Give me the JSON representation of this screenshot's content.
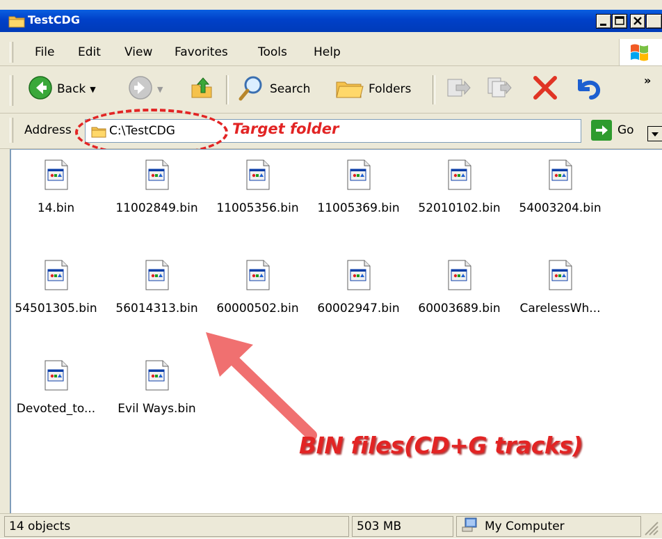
{
  "window": {
    "title": "TestCDG"
  },
  "menu": [
    "File",
    "Edit",
    "View",
    "Favorites",
    "Tools",
    "Help"
  ],
  "toolbar": {
    "back_label": "Back",
    "search_label": "Search",
    "folders_label": "Folders",
    "more": "»"
  },
  "address": {
    "label": "Address",
    "value": "C:\\TestCDG",
    "go_label": "Go"
  },
  "annotations": {
    "target_folder": "Target folder",
    "bin_files": "BIN files(CD+G tracks)"
  },
  "files": [
    "14.bin",
    "11002849.bin",
    "11005356.bin",
    "11005369.bin",
    "52010102.bin",
    "54003204.bin",
    "54501305.bin",
    "56014313.bin",
    "60000502.bin",
    "60002947.bin",
    "60003689.bin",
    "CarelessWh...",
    "Devoted_to...",
    "Evil Ways.bin"
  ],
  "status": {
    "objects": "14 objects",
    "size": "503 MB",
    "location": "My Computer"
  },
  "icons": {
    "file": "bin-file-icon",
    "folder": "folder-icon",
    "back": "back-arrow-icon",
    "forward": "forward-arrow-icon"
  }
}
